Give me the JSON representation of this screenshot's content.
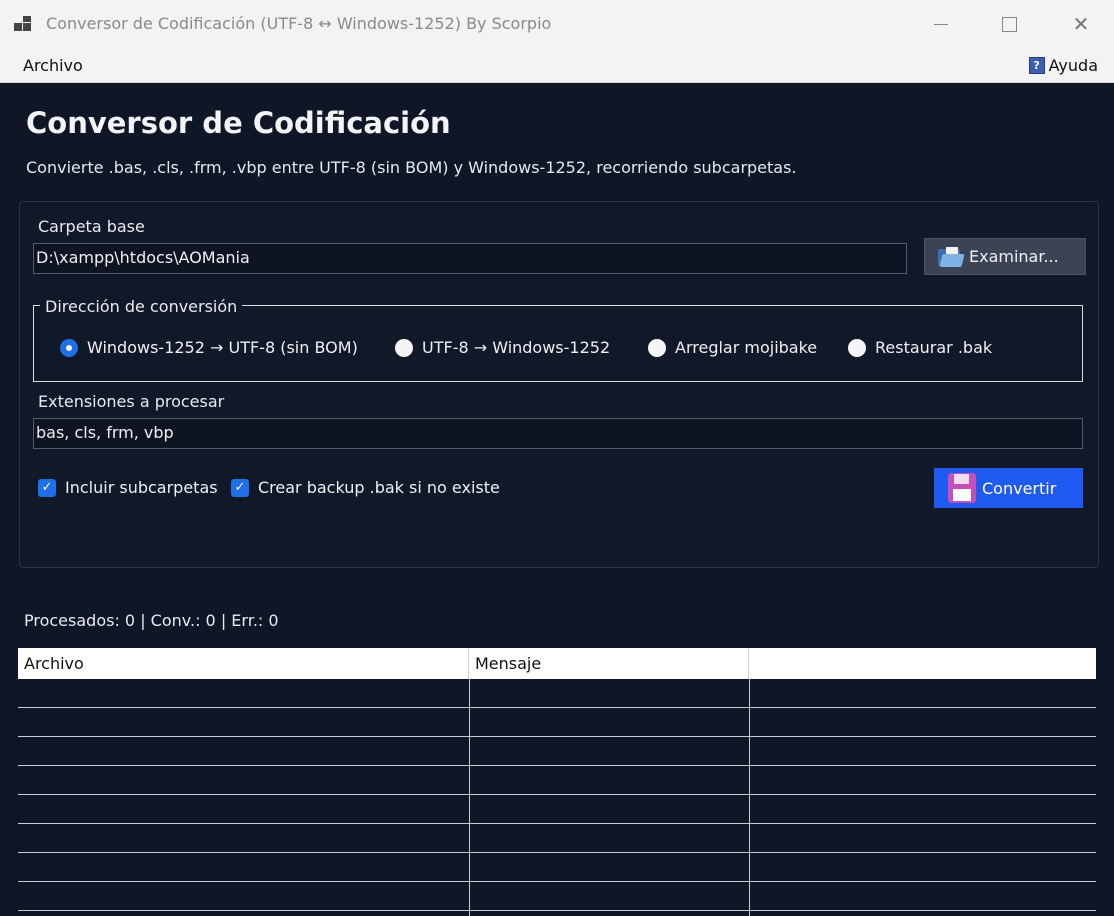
{
  "window": {
    "title": "Conversor de Codificación (UTF-8 ↔ Windows-1252) By Scorpio",
    "controls": [
      "minimize-icon",
      "maximize-icon",
      "close-icon"
    ],
    "close_glyph": "✕"
  },
  "menu": {
    "archivo": "Archivo",
    "ayuda": "Ayuda",
    "ayuda_icon_glyph": "?"
  },
  "header": {
    "title": "Conversor de Codificación",
    "description": "Convierte .bas, .cls, .frm, .vbp entre UTF-8 (sin BOM) y Windows-1252, recorriendo subcarpetas."
  },
  "form": {
    "base_folder_label": "Carpeta base",
    "base_folder_value": "D:\\xampp\\htdocs\\AOMania",
    "browse_label": "Examinar...",
    "direction_legend": "Dirección de conversión",
    "directions": [
      {
        "label": "Windows-1252 → UTF-8 (sin BOM)",
        "selected": true
      },
      {
        "label": "UTF-8 → Windows-1252",
        "selected": false
      },
      {
        "label": "Arreglar mojibake",
        "selected": false
      },
      {
        "label": "Restaurar .bak",
        "selected": false
      }
    ],
    "extensions_label": "Extensiones a procesar",
    "extensions_value": "bas, cls, frm, vbp",
    "include_subfolders_label": "Incluir subcarpetas",
    "include_subfolders_checked": true,
    "backup_label": "Crear backup .bak si no existe",
    "backup_checked": true,
    "check_glyph": "✓",
    "convert_label": "Convertir"
  },
  "status": {
    "text": "Procesados: 0 | Conv.: 0 | Err.: 0"
  },
  "table": {
    "columns": [
      "Archivo",
      "Mensaje",
      ""
    ],
    "rows": []
  },
  "colors": {
    "background": "#0f1626",
    "accent": "#1e6fe8",
    "convert_button": "#1f5bf0",
    "titlebar": "#f3f3f3"
  }
}
